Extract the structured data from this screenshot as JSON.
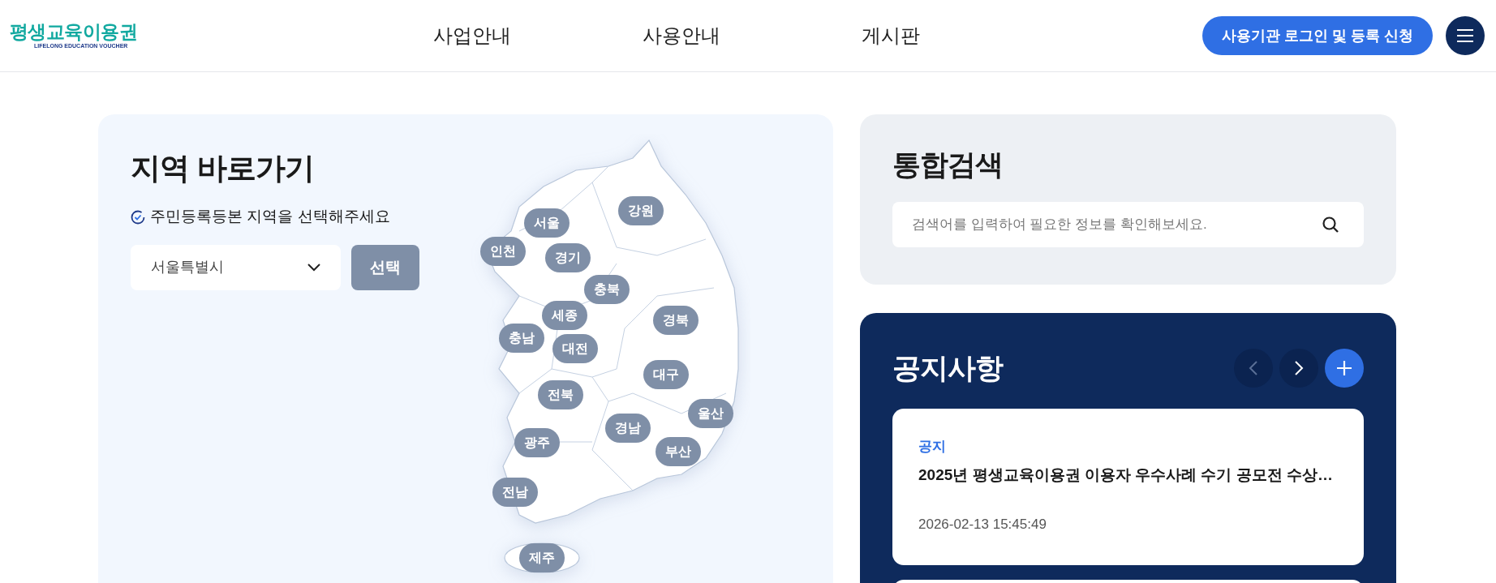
{
  "header": {
    "logo": {
      "title": "평생교육이용권",
      "subtitle": "LIFELONG EDUCATION VOUCHER"
    },
    "nav": [
      "사업안내",
      "사용안내",
      "게시판"
    ],
    "login_button": "사용기관 로그인 및 등록 신청"
  },
  "region_panel": {
    "title": "지역 바로가기",
    "instruction": "주민등록등본 지역을 선택해주세요",
    "select": {
      "value": "서울특별시"
    },
    "button": "선택",
    "regions": [
      {
        "label": "서울"
      },
      {
        "label": "강원"
      },
      {
        "label": "인천"
      },
      {
        "label": "경기"
      },
      {
        "label": "충북"
      },
      {
        "label": "세종"
      },
      {
        "label": "경북"
      },
      {
        "label": "충남"
      },
      {
        "label": "대전"
      },
      {
        "label": "대구"
      },
      {
        "label": "전북"
      },
      {
        "label": "울산"
      },
      {
        "label": "경남"
      },
      {
        "label": "광주"
      },
      {
        "label": "부산"
      },
      {
        "label": "전남"
      },
      {
        "label": "제주"
      }
    ]
  },
  "search_panel": {
    "title": "통합검색",
    "placeholder": "검색어를 입력하여 필요한 정보를 확인해보세요."
  },
  "notice_panel": {
    "title": "공지사항",
    "items": [
      {
        "tag": "공지",
        "title": "2025년 평생교육이용권 이용자 우수사례 수기 공모전 수상…",
        "date": "2026-02-13 15:45:49"
      }
    ]
  }
}
